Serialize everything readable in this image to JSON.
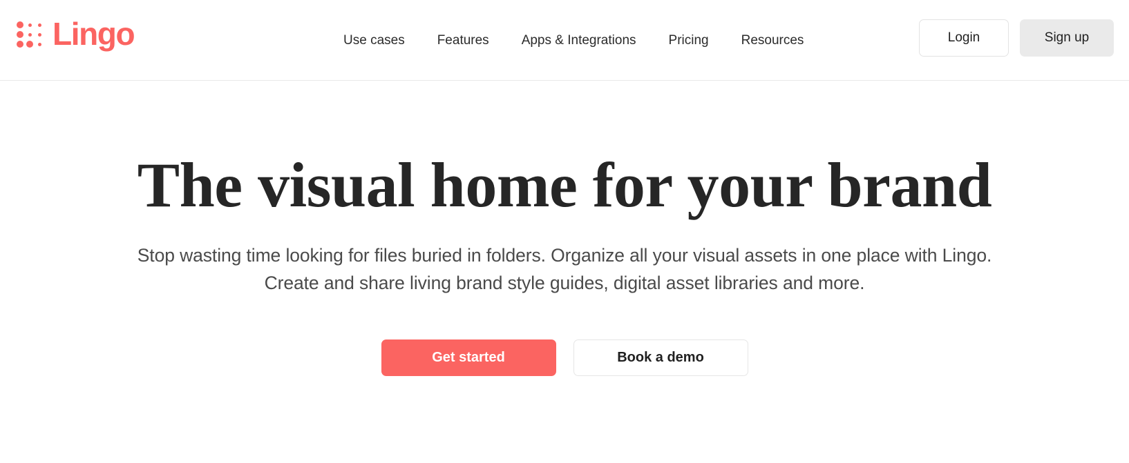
{
  "brand": {
    "name": "Lingo",
    "accent_color": "#fb6461",
    "logo_icon": "lingo-dot-grid-icon",
    "dot_grid": [
      [
        "lg",
        "sm",
        "sm"
      ],
      [
        "lg",
        "sm",
        "sm"
      ],
      [
        "lg",
        "lg",
        "sm"
      ]
    ]
  },
  "header": {
    "nav_items": [
      {
        "label": "Use cases"
      },
      {
        "label": "Features"
      },
      {
        "label": "Apps & Integrations"
      },
      {
        "label": "Pricing"
      },
      {
        "label": "Resources"
      }
    ],
    "login_label": "Login",
    "signup_label": "Sign up",
    "login_bg": "#ffffff",
    "signup_bg": "#eaeaea",
    "border_color": "#e8e8e8"
  },
  "hero": {
    "title": "The visual home for your brand",
    "subtitle": "Stop wasting time looking for files buried in folders. Organize all your visual assets in one place with Lingo. Create and share living brand style guides, digital asset libraries and more.",
    "primary_cta": "Get started",
    "secondary_cta": "Book a demo",
    "primary_cta_color": "#fb6461",
    "title_color": "#262626",
    "subtitle_color": "#4a4a4a"
  }
}
